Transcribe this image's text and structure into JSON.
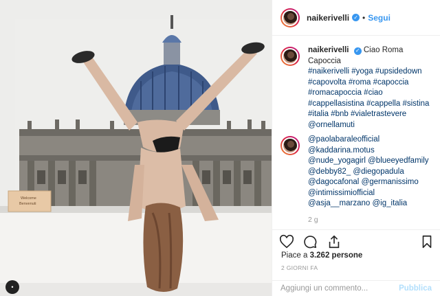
{
  "post": {
    "username": "naikerivelli",
    "verified": true,
    "follow_label": "Segui",
    "separator": "•",
    "caption_text": "Ciao Roma Capoccia",
    "caption_tags": "#naikerivelli #yoga #upsidedown #capovolta #roma #capoccia #romacapoccia #ciao #cappellasistina #cappella #sistina #italia #bnb #vialetrastevere @ornellamuti",
    "caption_time": "",
    "second_comment": "@paolabaraleofficial @kaddarina.motus @nude_yogagirl @blueeyedfamily @debby82_ @diegopadula @dagocafonal @germanissimo @intimissimiofficial @asja__marzano @ig_italia",
    "comment_time": "2 g",
    "likes_prefix": "Piace a ",
    "likes_count": "3.262",
    "likes_suffix": " persone",
    "date_label": "2 GIORNI FA",
    "comment_placeholder": "Aggiungi un commento...",
    "publish_label": "Pubblica"
  },
  "photo": {
    "sign_line1": "Welcome",
    "sign_line2": "Benvenuti"
  },
  "icons": {
    "like": "heart-icon",
    "comment": "comment-icon",
    "share": "share-icon",
    "save": "bookmark-icon",
    "verified": "verified-badge-icon"
  },
  "colors": {
    "accent": "#3897f0",
    "tag_link": "#003569",
    "muted": "#999999",
    "publish_disabled": "#b2dffc"
  }
}
